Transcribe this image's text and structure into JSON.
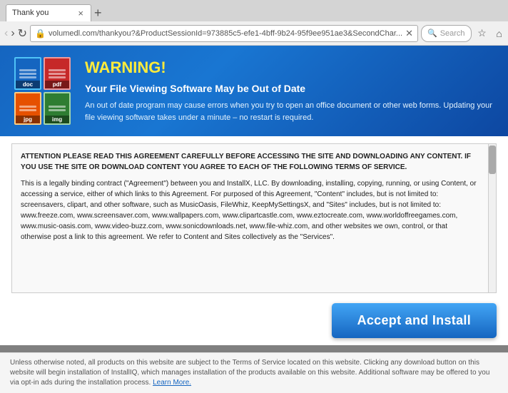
{
  "browser": {
    "tab": {
      "title": "Thank you",
      "close_icon": "×"
    },
    "tab_new_icon": "+",
    "nav": {
      "back_icon": "‹",
      "forward_icon": "›",
      "reload_icon": "↻",
      "url": "volumedl.com/thankyou?&ProductSessionId=973885c5-efe1-4bff-9b24-95f9ee951ae3&SecondChar...",
      "search_placeholder": "Search"
    },
    "toolbar": {
      "star_icon": "★",
      "home_icon": "⌂",
      "download_icon": "↓",
      "bookmark_icon": "☰"
    }
  },
  "warning": {
    "title": "WARNING!",
    "subtitle": "Your File Viewing Software May be Out of Date",
    "body": "An out of date program may cause errors when you try to open an office document or other web forms. Updating your file viewing software takes under a minute – no restart is required.",
    "files": [
      {
        "ext": "doc",
        "color": "#1565c0"
      },
      {
        "ext": "pdf",
        "color": "#c62828"
      },
      {
        "ext": "jpg",
        "color": "#e65100"
      },
      {
        "ext": "",
        "color": "#2e7d32"
      }
    ]
  },
  "terms": {
    "heading": "ATTENTION PLEASE READ THIS AGREEMENT CAREFULLY BEFORE ACCESSING THE SITE AND DOWNLOADING ANY CONTENT. IF YOU USE THE SITE OR DOWNLOAD CONTENT YOU AGREE TO EACH OF THE FOLLOWING TERMS OF SERVICE.",
    "body": "This is a legally binding contract (\"Agreement\") between you and InstallX, LLC. By downloading, installing, copying, running, or using Content, or accessing a service, either of which links to this Agreement. For purposed of this Agreement, \"Content\" includes, but is not limited to: screensavers, clipart, and other software, such as MusicOasis, FileWhiz, KeepMySettingsX, and \"Sites\" includes, but is not limited to: www.freeze.com, www.screensaver.com, www.wallpapers.com, www.clipartcastle.com, www.eztocreate.com, www.worldoffreegames.com, www.music-oasis.com, www.video-buzz.com, www.sonicdownloads.net, www.file-whiz.com, and other websites we own, control, or that otherwise post a link to this agreement. We refer to Content and Sites collectively as the \"Services\"."
  },
  "accept_button": {
    "label": "Accept and Install"
  },
  "footer": {
    "text": "Unless otherwise noted, all products on this website are subject to the Terms of Service located on this website. Clicking any download button on this website will begin installation of InstallIQ, which manages installation of the products available on this website. Additional software may be offered to you via opt-in ads during the installation process.",
    "learn_more": "Learn More."
  }
}
